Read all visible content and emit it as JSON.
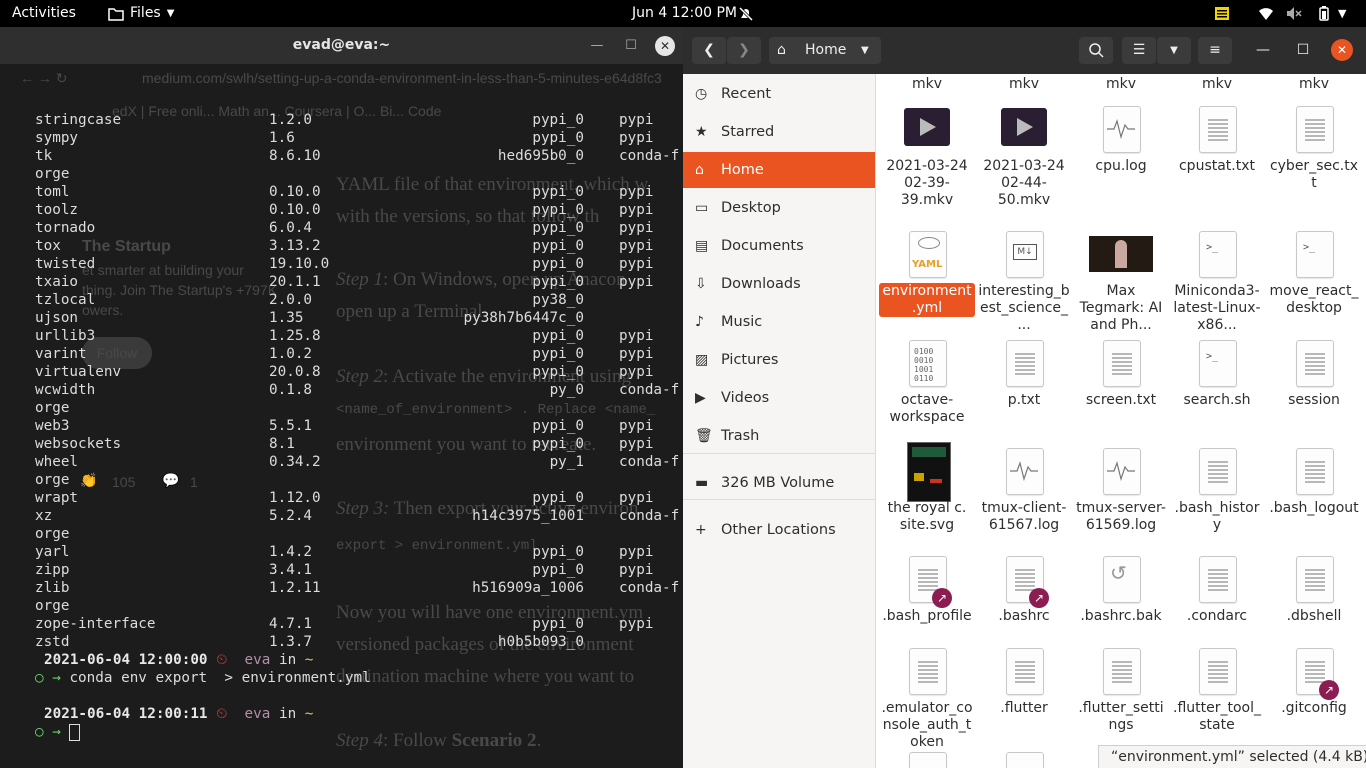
{
  "topbar": {
    "activities": "Activities",
    "app_menu": "Files",
    "clock": "Jun 4  12:00 PM"
  },
  "terminal": {
    "title": "evad@eva:~",
    "rows": [
      {
        "name": "stringcase",
        "version": "1.2.0",
        "build": "pypi_0",
        "channel": "pypi"
      },
      {
        "name": "sympy",
        "version": "1.6",
        "build": "pypi_0",
        "channel": "pypi"
      },
      {
        "name": "tk",
        "version": "8.6.10",
        "build": "hed695b0_0",
        "channel": "conda-f"
      },
      {
        "name": "orge",
        "version": "",
        "build": "",
        "channel": ""
      },
      {
        "name": "toml",
        "version": "0.10.0",
        "build": "pypi_0",
        "channel": "pypi"
      },
      {
        "name": "toolz",
        "version": "0.10.0",
        "build": "pypi_0",
        "channel": "pypi"
      },
      {
        "name": "tornado",
        "version": "6.0.4",
        "build": "pypi_0",
        "channel": "pypi"
      },
      {
        "name": "tox",
        "version": "3.13.2",
        "build": "pypi_0",
        "channel": "pypi"
      },
      {
        "name": "twisted",
        "version": "19.10.0",
        "build": "pypi_0",
        "channel": "pypi"
      },
      {
        "name": "txaio",
        "version": "20.1.1",
        "build": "pypi_0",
        "channel": "pypi"
      },
      {
        "name": "tzlocal",
        "version": "2.0.0",
        "build": "py38_0",
        "channel": ""
      },
      {
        "name": "ujson",
        "version": "1.35",
        "build": "py38h7b6447c_0",
        "channel": ""
      },
      {
        "name": "urllib3",
        "version": "1.25.8",
        "build": "pypi_0",
        "channel": "pypi"
      },
      {
        "name": "varint",
        "version": "1.0.2",
        "build": "pypi_0",
        "channel": "pypi"
      },
      {
        "name": "virtualenv",
        "version": "20.0.8",
        "build": "pypi_0",
        "channel": "pypi"
      },
      {
        "name": "wcwidth",
        "version": "0.1.8",
        "build": "py_0",
        "channel": "conda-f"
      },
      {
        "name": "orge",
        "version": "",
        "build": "",
        "channel": ""
      },
      {
        "name": "web3",
        "version": "5.5.1",
        "build": "pypi_0",
        "channel": "pypi"
      },
      {
        "name": "websockets",
        "version": "8.1",
        "build": "pypi_0",
        "channel": "pypi"
      },
      {
        "name": "wheel",
        "version": "0.34.2",
        "build": "py_1",
        "channel": "conda-f"
      },
      {
        "name": "orge",
        "version": "",
        "build": "",
        "channel": ""
      },
      {
        "name": "wrapt",
        "version": "1.12.0",
        "build": "pypi_0",
        "channel": "pypi"
      },
      {
        "name": "xz",
        "version": "5.2.4",
        "build": "h14c3975_1001",
        "channel": "conda-f"
      },
      {
        "name": "orge",
        "version": "",
        "build": "",
        "channel": ""
      },
      {
        "name": "yarl",
        "version": "1.4.2",
        "build": "pypi_0",
        "channel": "pypi"
      },
      {
        "name": "zipp",
        "version": "3.4.1",
        "build": "pypi_0",
        "channel": "pypi"
      },
      {
        "name": "zlib",
        "version": "1.2.11",
        "build": "h516909a_1006",
        "channel": "conda-f"
      },
      {
        "name": "orge",
        "version": "",
        "build": "",
        "channel": ""
      },
      {
        "name": "zope-interface",
        "version": "4.7.1",
        "build": "pypi_0",
        "channel": "pypi"
      },
      {
        "name": "zstd",
        "version": "1.3.7",
        "build": "h0b5b093_0",
        "channel": ""
      }
    ],
    "prompt1_date": "2021-06-04 12:00:00",
    "prompt1_user": "eva",
    "prompt1_in": "in",
    "prompt1_dir": "~",
    "prompt1_cmd": "conda env export  > environment.yml",
    "prompt2_date": "2021-06-04 12:00:11",
    "prompt2_user": "eva",
    "prompt2_in": "in",
    "prompt2_dir": "~",
    "prompt_arrow": "○ →",
    "clock_icon": "⏲"
  },
  "background_browser": {
    "url": "medium.com/swlh/setting-up-a-conda-environment-in-less-than-5-minutes-e64d8fc3",
    "bookmarks": "edX | Free onli...    Math an...   Coursera | O...   Bi...   Code",
    "p1": "YAML file of that environment, which w",
    "p1b": "with the versions, so that follow th",
    "sidebar1": "The Startup",
    "sidebar2": "et smarter at building your",
    "sidebar3": "thing. Join The Startup's +797K",
    "sidebar4": "owers.",
    "follow": "Follow",
    "step1a": "Step 1",
    "step1b": ": On Windows, open up Anacon",
    "step1c": "open up a Terminal.",
    "step2a": "Step 2",
    "step2b": ": Activate the environment using",
    "step2c": "<name_of_environment> . Replace  <name_",
    "step2d": "environment you want to recreate.",
    "claps": "105",
    "comments": "1",
    "step3a": "Step 3:",
    "step3b": " Then export your active environ",
    "code": "export > environment.yml",
    "p4a": "Now you will have one environment.ym",
    "p4b": "versioned packages of the environment",
    "p4c": "destination machine where you want to",
    "step4a": "Step 4",
    "step4b": ": Follow ",
    "step4c": "Scenario 2",
    "step4d": "."
  },
  "filemanager": {
    "location": "Home",
    "sidebar": [
      {
        "label": "Recent",
        "icon": "clock-icon"
      },
      {
        "label": "Starred",
        "icon": "star-icon"
      },
      {
        "label": "Home",
        "icon": "home-icon",
        "active": true
      },
      {
        "label": "Desktop",
        "icon": "desktop-icon"
      },
      {
        "label": "Documents",
        "icon": "documents-icon"
      },
      {
        "label": "Downloads",
        "icon": "download-icon"
      },
      {
        "label": "Music",
        "icon": "music-icon"
      },
      {
        "label": "Pictures",
        "icon": "pictures-icon"
      },
      {
        "label": "Videos",
        "icon": "videos-icon"
      },
      {
        "label": "Trash",
        "icon": "trash-icon"
      },
      {
        "label": "326 MB Volume",
        "icon": "drive-icon"
      },
      {
        "label": "Other Locations",
        "icon": "plus-icon"
      }
    ],
    "top_row_partial": [
      "mkv",
      "mkv",
      "mkv",
      "mkv",
      "mkv"
    ],
    "files": [
      {
        "label": "2021-03-24 02-39-39.mkv",
        "type": "video"
      },
      {
        "label": "2021-03-24 02-44-50.mkv",
        "type": "video"
      },
      {
        "label": "cpu.log",
        "type": "log"
      },
      {
        "label": "cpustat.txt",
        "type": "text"
      },
      {
        "label": "cyber_sec.txt",
        "type": "text"
      },
      {
        "label": "environment.yml",
        "type": "yaml",
        "selected": true
      },
      {
        "label": "interesting_best_science_...",
        "type": "markdown"
      },
      {
        "label": "Max Tegmark: AI and Ph...",
        "type": "image"
      },
      {
        "label": "Miniconda3-latest-Linux-x86...",
        "type": "script"
      },
      {
        "label": "move_react_desktop",
        "type": "script"
      },
      {
        "label": "octave-workspace",
        "type": "binary"
      },
      {
        "label": "p.txt",
        "type": "text"
      },
      {
        "label": "screen.txt",
        "type": "text"
      },
      {
        "label": "search.sh",
        "type": "script"
      },
      {
        "label": "session",
        "type": "text"
      },
      {
        "label": "the royal c. site.svg",
        "type": "svg"
      },
      {
        "label": "tmux-client-61567.log",
        "type": "log"
      },
      {
        "label": "tmux-server-61569.log",
        "type": "log"
      },
      {
        "label": ".bash_history",
        "type": "text"
      },
      {
        "label": ".bash_logout",
        "type": "text"
      },
      {
        "label": ".bash_profile",
        "type": "link"
      },
      {
        "label": ".bashrc",
        "type": "link"
      },
      {
        "label": ".bashrc.bak",
        "type": "backup"
      },
      {
        "label": ".condarc",
        "type": "text"
      },
      {
        "label": ".dbshell",
        "type": "text"
      },
      {
        "label": ".emulator_console_auth_token",
        "type": "text"
      },
      {
        "label": ".flutter",
        "type": "text"
      },
      {
        "label": ".flutter_settings",
        "type": "text"
      },
      {
        "label": ".flutter_tool_state",
        "type": "text"
      },
      {
        "label": ".gitconfig",
        "type": "link"
      }
    ],
    "status": "“environment.yml” selected  (4.4 kB)",
    "accent": "#e95420"
  }
}
